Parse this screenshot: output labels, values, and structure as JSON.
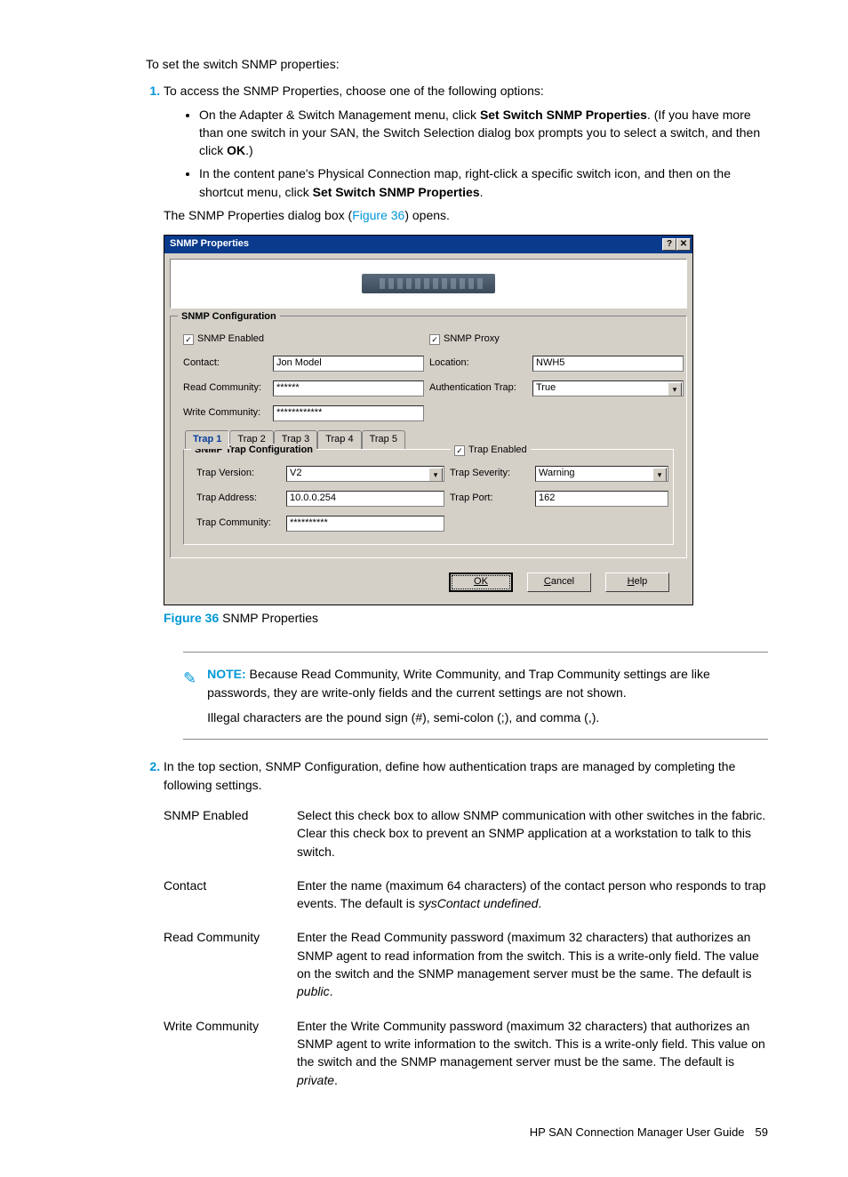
{
  "intro": "To set the switch SNMP properties:",
  "step1": {
    "lead": "To access the SNMP Properties, choose one of the following options:",
    "bullets": [
      {
        "pre": "On the Adapter & Switch Management menu, click ",
        "bold1": "Set Switch SNMP Properties",
        "mid": ". (If you have more than one switch in your SAN, the Switch Selection dialog box prompts you to select a switch, and then click ",
        "bold2": "OK",
        "post": ".)"
      },
      {
        "pre": "In the content pane's Physical Connection map, right-click a specific switch icon, and then on the shortcut menu, click ",
        "bold1": "Set Switch SNMP Properties",
        "mid": ".",
        "bold2": "",
        "post": ""
      }
    ],
    "after_pre": "The SNMP Properties dialog box (",
    "after_link": "Figure 36",
    "after_post": ") opens."
  },
  "dialog": {
    "title": "SNMP Properties",
    "help_btn": "?",
    "close_btn": "✕",
    "group1_title": "SNMP Configuration",
    "snmp_enabled_label": "SNMP Enabled",
    "snmp_proxy_label": "SNMP Proxy",
    "contact_label": "Contact:",
    "contact_value": "Jon Model",
    "location_label": "Location:",
    "location_value": "NWH5",
    "read_comm_label": "Read Community:",
    "read_comm_value": "******",
    "auth_trap_label": "Authentication Trap:",
    "auth_trap_value": "True",
    "write_comm_label": "Write Community:",
    "write_comm_value": "************",
    "tabs": [
      "Trap 1",
      "Trap 2",
      "Trap 3",
      "Trap 4",
      "Trap 5"
    ],
    "group2_title": "SNMP Trap Configuration",
    "trap_enabled_label": "Trap Enabled",
    "trap_version_label": "Trap Version:",
    "trap_version_value": "V2",
    "trap_severity_label": "Trap Severity:",
    "trap_severity_value": "Warning",
    "trap_address_label": "Trap Address:",
    "trap_address_value": "10.0.0.254",
    "trap_port_label": "Trap Port:",
    "trap_port_value": "162",
    "trap_comm_label": "Trap Community:",
    "trap_comm_value": "**********",
    "ok": "OK",
    "cancel": "Cancel",
    "help": "Help"
  },
  "caption": {
    "label": "Figure 36",
    "text": " SNMP Properties"
  },
  "note": {
    "label": "NOTE:",
    "line1": "Because Read Community, Write Community, and Trap Community settings are like passwords, they are write-only fields and the current settings are not shown.",
    "line2": "Illegal characters are the pound sign (#), semi-colon (;), and comma (,)."
  },
  "step2": {
    "lead": "In the top section, SNMP Configuration, define how authentication traps are managed by completing the following settings.",
    "defs": [
      {
        "term": "SNMP Enabled",
        "desc": "Select this check box to allow SNMP communication with other switches in the fabric. Clear this check box to prevent an SNMP application at a workstation to talk to this switch."
      },
      {
        "term": "Contact",
        "desc_pre": "Enter the name (maximum 64 characters) of the contact person who responds to trap events. The default is ",
        "desc_it": "sysContact undefined",
        "desc_post": "."
      },
      {
        "term": "Read Community",
        "desc_pre": "Enter the Read Community password (maximum 32 characters) that authorizes an SNMP agent to read information from the switch. This is a write-only field. The value on the switch and the SNMP management server must be the same. The default is ",
        "desc_it": "public",
        "desc_post": "."
      },
      {
        "term": "Write Community",
        "desc_pre": "Enter the Write Community password (maximum 32 characters) that authorizes an SNMP agent to write information to the switch. This is a write-only field. This value on the switch and the SNMP management server must be the same. The default is ",
        "desc_it": "private",
        "desc_post": "."
      }
    ]
  },
  "footer": {
    "doc": "HP SAN Connection Manager User Guide",
    "page": "59"
  }
}
